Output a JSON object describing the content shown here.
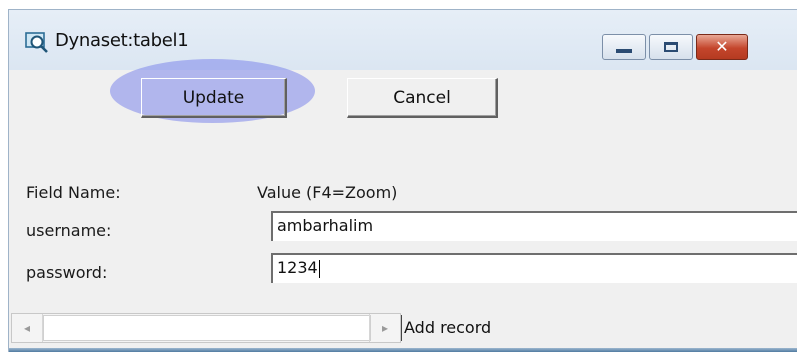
{
  "window": {
    "title": "Dynaset:tabel1",
    "icon": "search-window-icon",
    "controls": {
      "minimize": "minimize-icon",
      "maximize": "maximize-icon",
      "close": "close-icon"
    }
  },
  "toolbar": {
    "update_label": "Update",
    "cancel_label": "Cancel"
  },
  "grid": {
    "field_name_header": "Field Name:",
    "value_header": "Value (F4=Zoom)",
    "rows": [
      {
        "label": "username:",
        "value": "ambarhalim"
      },
      {
        "label": "password:",
        "value": "1234"
      }
    ]
  },
  "navigation": {
    "left_arrow": "◂",
    "right_arrow": "▸",
    "status_text": "Add record"
  },
  "colors": {
    "highlight": "#7d87eb",
    "close_button": "#c4462c",
    "titlebar": "#dbe6f2"
  }
}
